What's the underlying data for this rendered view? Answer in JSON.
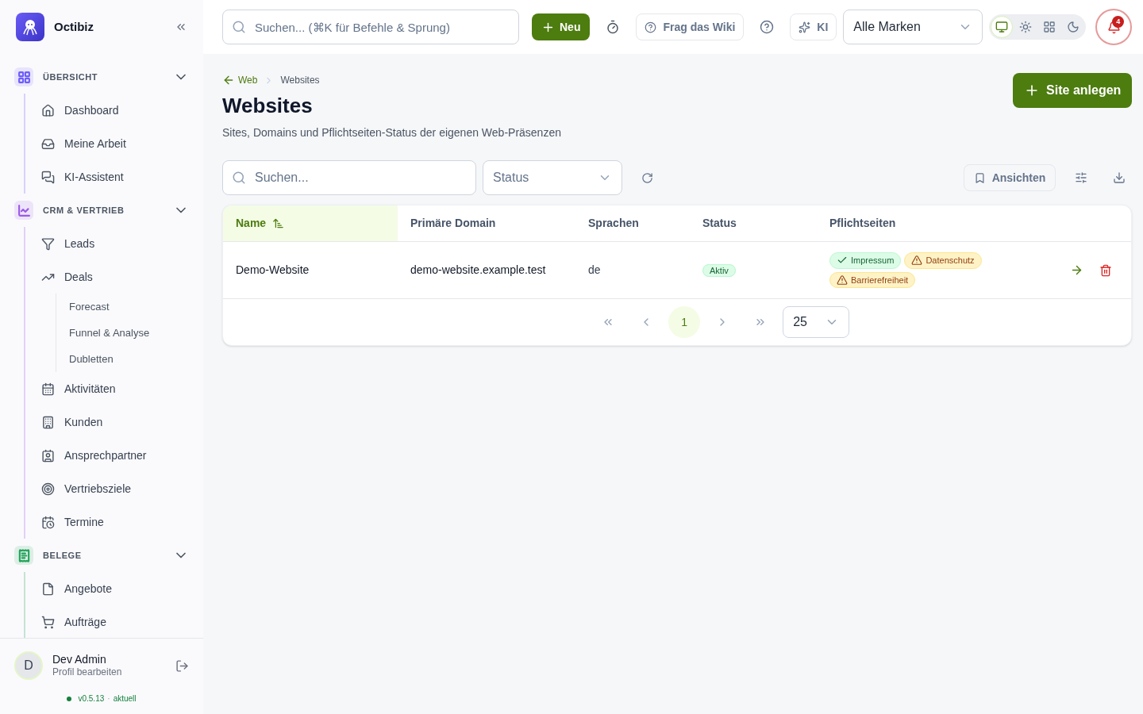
{
  "brand": {
    "name": "Octibiz"
  },
  "sidebar": {
    "sections": [
      {
        "title": "ÜBERSICHT",
        "color": "#6d5dfc",
        "expanded": true,
        "items": [
          {
            "label": "Dashboard"
          },
          {
            "label": "Meine Arbeit"
          },
          {
            "label": "KI-Assistent"
          }
        ]
      },
      {
        "title": "CRM & VERTRIEB",
        "color": "#9b59e6",
        "expanded": true,
        "items": [
          {
            "label": "Leads"
          },
          {
            "label": "Deals",
            "children": [
              {
                "label": "Forecast"
              },
              {
                "label": "Funnel & Analyse"
              },
              {
                "label": "Dubletten"
              }
            ]
          },
          {
            "label": "Aktivitäten"
          },
          {
            "label": "Kunden"
          },
          {
            "label": "Ansprechpartner"
          },
          {
            "label": "Vertriebsziele"
          },
          {
            "label": "Termine"
          }
        ]
      },
      {
        "title": "BELEGE",
        "color": "#22a35a",
        "expanded": true,
        "items": [
          {
            "label": "Angebote"
          },
          {
            "label": "Aufträge"
          }
        ]
      }
    ]
  },
  "user": {
    "initial": "D",
    "name": "Dev Admin",
    "subtitle": "Profil bearbeiten"
  },
  "version": {
    "number": "v0.5.13",
    "separator": "·",
    "status": "aktuell"
  },
  "topbar": {
    "search_placeholder": "Suchen... (⌘K für Befehle & Sprung)",
    "new_button": "Neu",
    "wiki_button": "Frag das Wiki",
    "ai_button": "KI",
    "brand_select": "Alle Marken",
    "theme_modes": [
      {
        "selected": true
      },
      {
        "selected": false
      },
      {
        "selected": false
      },
      {
        "selected": false
      }
    ],
    "notifications": "4"
  },
  "breadcrumb": {
    "back": "Web",
    "current": "Websites"
  },
  "page": {
    "title": "Websites",
    "subtitle": "Sites, Domains und Pflichtseiten-Status der eigenen Web-Präsenzen",
    "primary_button": "Site anlegen"
  },
  "filters": {
    "search_placeholder": "Suchen...",
    "status_placeholder": "Status",
    "views_button": "Ansichten"
  },
  "table": {
    "columns": [
      {
        "label": "Name",
        "sorted": true
      },
      {
        "label": "Primäre Domain",
        "sorted": false
      },
      {
        "label": "Sprachen",
        "sorted": false
      },
      {
        "label": "Status",
        "sorted": false
      },
      {
        "label": "Pflichtseiten",
        "sorted": false
      }
    ],
    "rows": [
      {
        "name": "Demo-Website",
        "domain": "demo-website.example.test",
        "languages": "de",
        "status": "Aktiv",
        "pages": [
          {
            "label": "Impressum",
            "kind": "ok"
          },
          {
            "label": "Datenschutz",
            "kind": "warning"
          },
          {
            "label": "Barrierefreiheit",
            "kind": "warning"
          }
        ]
      }
    ]
  },
  "pagination": {
    "pages": [
      {
        "label": "1",
        "selected": true
      }
    ],
    "page_size": "25"
  }
}
